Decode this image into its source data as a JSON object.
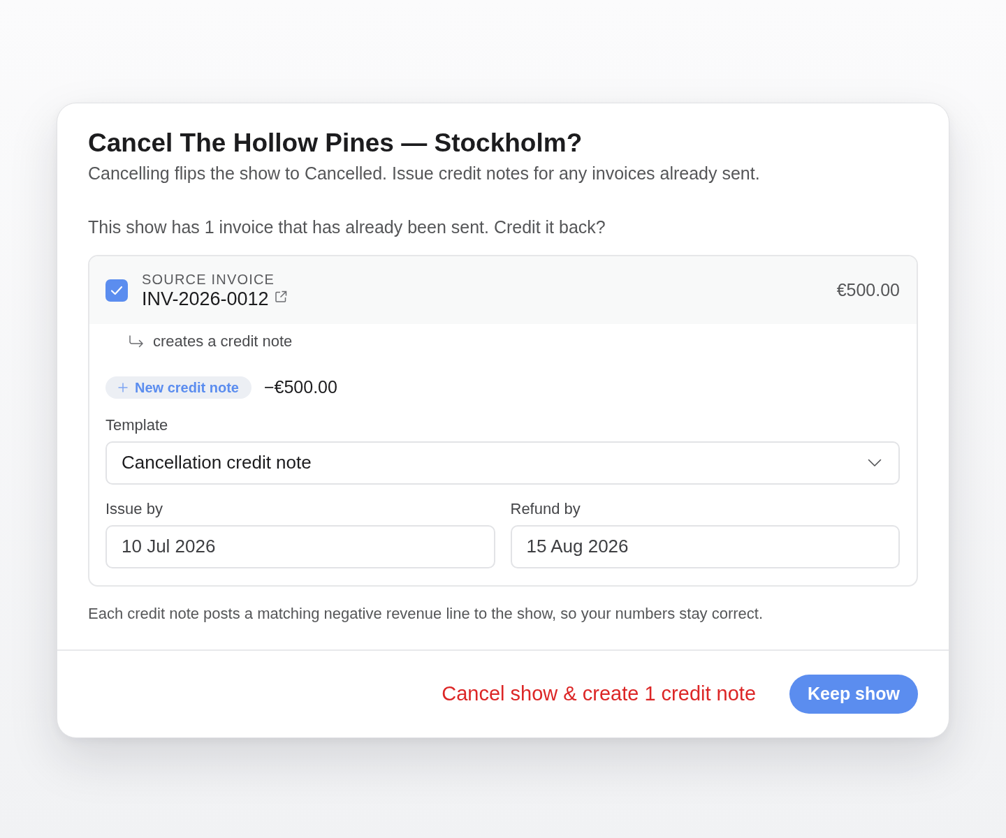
{
  "dialog": {
    "title": "Cancel The Hollow Pines — Stockholm?",
    "subtitle": "Cancelling flips the show to Cancelled. Issue credit notes for any invoices already sent."
  },
  "prompt": "This show has 1 invoice that has already been sent. Credit it back?",
  "invoices": [
    {
      "checked": true,
      "label": "SOURCE INVOICE",
      "number": "INV-2026-0012",
      "amount": "€500.00",
      "creates_label": "creates a credit note",
      "new_button": "New credit note",
      "credit_amount": "−€500.00",
      "template": {
        "label": "Template",
        "value": "Cancellation credit note"
      },
      "dates": [
        {
          "label": "Issue by",
          "value": "10 Jul 2026"
        },
        {
          "label": "Refund by",
          "value": "15 Aug 2026"
        }
      ]
    }
  ],
  "note": "Each credit note posts a matching negative revenue line to the show, so your numbers stay correct.",
  "actions": [
    {
      "kind": "danger",
      "label": "Cancel show & create 1 credit note"
    },
    {
      "kind": "primary",
      "label": "Keep show"
    }
  ]
}
